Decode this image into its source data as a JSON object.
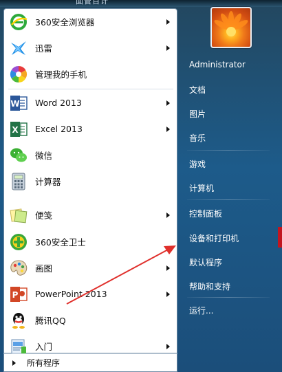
{
  "window": {
    "top_text": "面管百计"
  },
  "left_menu": {
    "items": [
      {
        "id": "360browser",
        "label": "360安全浏览器",
        "has_submenu": true,
        "icon": "360-browser-icon"
      },
      {
        "id": "xunlei",
        "label": "迅雷",
        "has_submenu": true,
        "icon": "xunlei-icon"
      },
      {
        "id": "phone",
        "label": "管理我的手机",
        "has_submenu": false,
        "icon": "phone-manager-icon"
      },
      {
        "id": "word",
        "label": "Word 2013",
        "has_submenu": true,
        "icon": "word-icon"
      },
      {
        "id": "excel",
        "label": "Excel 2013",
        "has_submenu": true,
        "icon": "excel-icon"
      },
      {
        "id": "wechat",
        "label": "微信",
        "has_submenu": false,
        "icon": "wechat-icon"
      },
      {
        "id": "calc",
        "label": "计算器",
        "has_submenu": false,
        "icon": "calculator-icon"
      },
      {
        "id": "notes",
        "label": "便笺",
        "has_submenu": true,
        "icon": "sticky-notes-icon"
      },
      {
        "id": "360safe",
        "label": "360安全卫士",
        "has_submenu": false,
        "icon": "360-safe-icon"
      },
      {
        "id": "paint",
        "label": "画图",
        "has_submenu": true,
        "icon": "paint-icon"
      },
      {
        "id": "ppt",
        "label": "PowerPoint 2013",
        "has_submenu": true,
        "icon": "powerpoint-icon"
      },
      {
        "id": "qq",
        "label": "腾讯QQ",
        "has_submenu": false,
        "icon": "qq-icon"
      },
      {
        "id": "intro",
        "label": "入门",
        "has_submenu": true,
        "icon": "getting-started-icon"
      }
    ],
    "all_programs": "所有程序"
  },
  "right_menu": {
    "user": "Administrator",
    "links": [
      "文档",
      "图片",
      "音乐",
      "游戏",
      "计算机",
      "控制面板",
      "设备和打印机",
      "默认程序",
      "帮助和支持",
      "运行..."
    ]
  },
  "colors": {
    "annotation_arrow": "#e0302c",
    "word_blue": "#2b579a",
    "excel_green": "#217346",
    "ppt_orange": "#d24726"
  }
}
